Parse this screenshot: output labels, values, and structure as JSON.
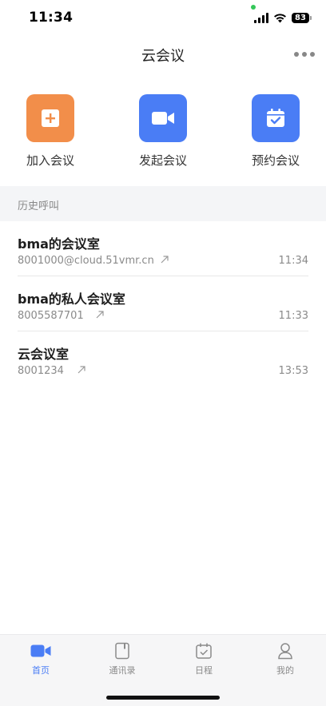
{
  "status_bar": {
    "time": "11:34",
    "battery": "83"
  },
  "header": {
    "title": "云会议",
    "more_icon": "more-horizontal-icon"
  },
  "colors": {
    "join": "#f28e4a",
    "start": "#4a7df5",
    "schedule": "#4a7df5",
    "accent": "#4a7df5",
    "inactive": "#8a8a8a"
  },
  "actions": [
    {
      "label": "加入会议",
      "icon": "plus-square-icon"
    },
    {
      "label": "发起会议",
      "icon": "video-camera-icon"
    },
    {
      "label": "预约会议",
      "icon": "calendar-check-icon"
    }
  ],
  "history": {
    "title": "历史呼叫",
    "items": [
      {
        "name": "bma的会议室",
        "number": "8001000@cloud.51vmr.cn",
        "time": "11:34"
      },
      {
        "name": "bma的私人会议室",
        "number": "8005587701",
        "time": "11:33"
      },
      {
        "name": "云会议室",
        "number": "8001234",
        "time": "13:53"
      }
    ]
  },
  "tabs": [
    {
      "label": "首页",
      "icon": "video-camera-icon",
      "active": true
    },
    {
      "label": "通讯录",
      "icon": "contacts-book-icon",
      "active": false
    },
    {
      "label": "日程",
      "icon": "calendar-check-icon",
      "active": false
    },
    {
      "label": "我的",
      "icon": "user-icon",
      "active": false
    }
  ]
}
